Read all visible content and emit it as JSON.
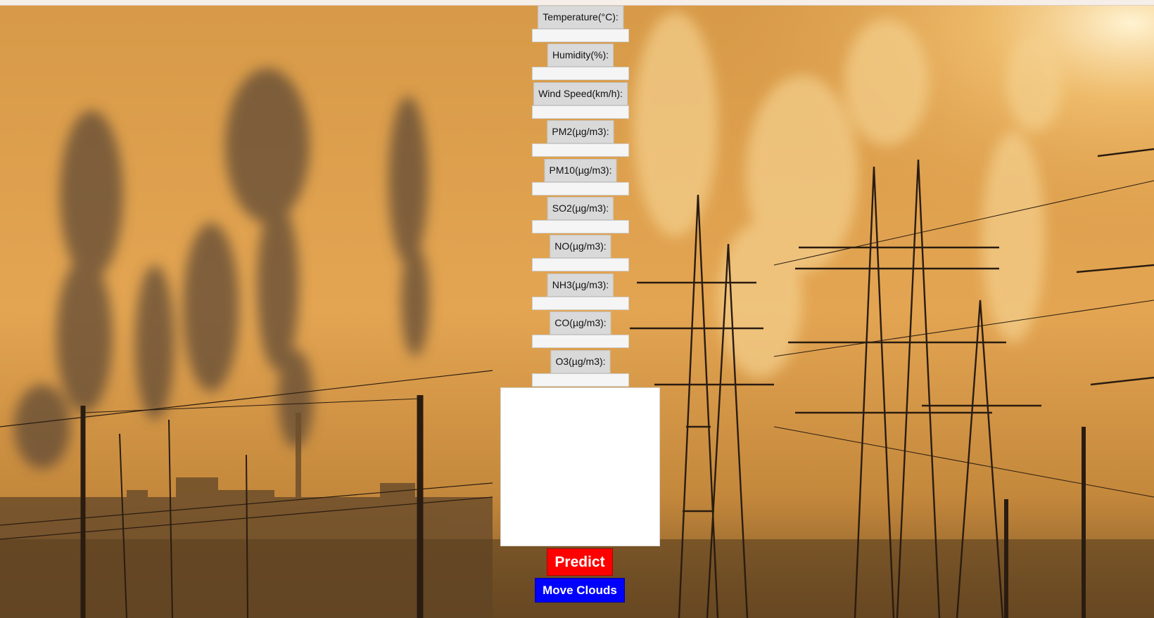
{
  "form": {
    "fields": [
      {
        "label": "Temperature(°C):",
        "value": ""
      },
      {
        "label": "Humidity(%):",
        "value": ""
      },
      {
        "label": "Wind Speed(km/h):",
        "value": ""
      },
      {
        "label": "PM2(µg/m3):",
        "value": ""
      },
      {
        "label": "PM10(µg/m3):",
        "value": ""
      },
      {
        "label": "SO2(µg/m3):",
        "value": ""
      },
      {
        "label": "NO(µg/m3):",
        "value": ""
      },
      {
        "label": "NH3(µg/m3):",
        "value": ""
      },
      {
        "label": "CO(µg/m3):",
        "value": ""
      },
      {
        "label": "O3(µg/m3):",
        "value": ""
      }
    ]
  },
  "output": {
    "text": ""
  },
  "buttons": {
    "predict_label": "Predict",
    "move_clouds_label": "Move Clouds"
  },
  "colors": {
    "predict_bg": "#ff0000",
    "move_clouds_bg": "#0000ff",
    "sky": "#e0a04a",
    "smoke": "#6b5540"
  }
}
